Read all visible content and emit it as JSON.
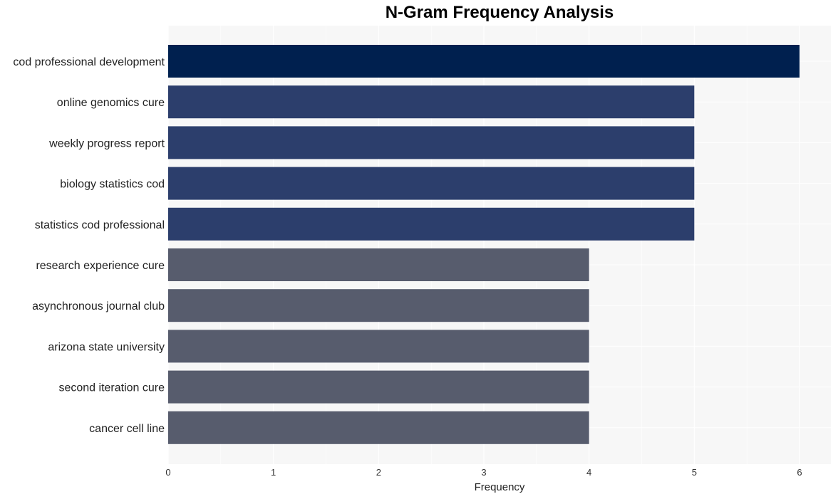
{
  "chart_data": {
    "type": "bar",
    "orientation": "horizontal",
    "title": "N-Gram Frequency Analysis",
    "xlabel": "Frequency",
    "ylabel": "",
    "xlim": [
      0,
      6.3
    ],
    "xticks": [
      0,
      1,
      2,
      3,
      4,
      5,
      6
    ],
    "grid": true,
    "categories": [
      "cod professional development",
      "online genomics cure",
      "weekly progress report",
      "biology statistics cod",
      "statistics cod professional",
      "research experience cure",
      "asynchronous journal club",
      "arizona state university",
      "second iteration cure",
      "cancer cell line"
    ],
    "values": [
      6,
      5,
      5,
      5,
      5,
      4,
      4,
      4,
      4,
      4
    ],
    "colors": {
      "6": "#00204f",
      "5": "#2c3e6c",
      "4": "#575c6d"
    },
    "background": "#f7f7f7",
    "gridline_color": "#ffffff"
  }
}
